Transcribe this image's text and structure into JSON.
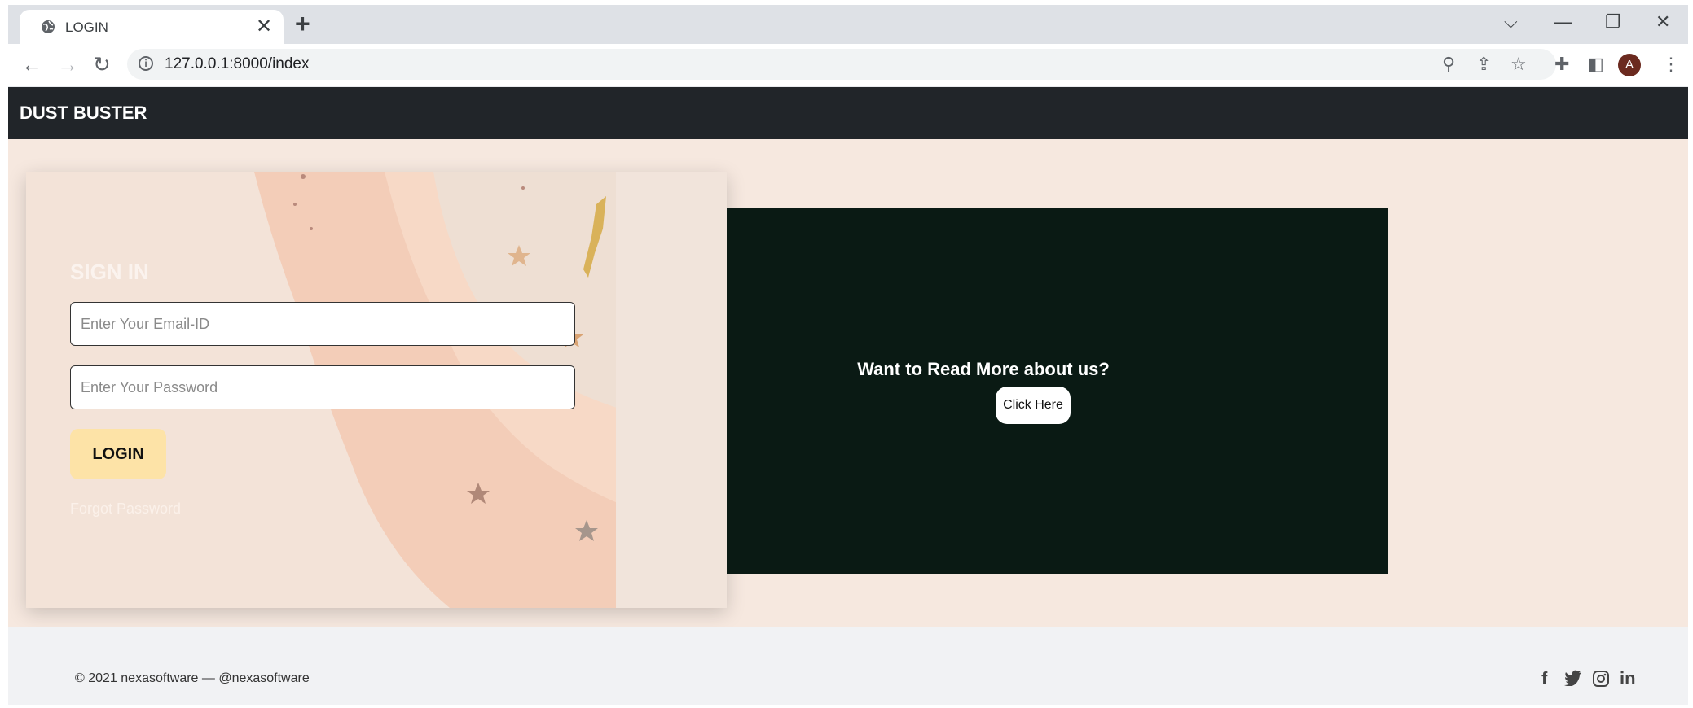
{
  "browser": {
    "tab_title": "LOGIN",
    "tab_close": "✕",
    "new_tab": "+",
    "url": "127.0.0.1:8000/index",
    "avatar_letter": "A",
    "icons": [
      "globe-icon",
      "back-icon",
      "forward-icon",
      "reload-icon",
      "info-icon",
      "zoom-icon",
      "share-icon",
      "star-icon",
      "extensions-icon",
      "sidepanel-icon",
      "menu-icon"
    ]
  },
  "navbar": {
    "brand": "DUST BUSTER"
  },
  "login": {
    "title": "SIGN IN",
    "email_placeholder": "Enter Your Email-ID",
    "password_placeholder": "Enter Your Password",
    "button": "LOGIN",
    "forgot": "Forgot Password"
  },
  "promo": {
    "text": "Want to Read More about us?",
    "button": "Click Here"
  },
  "footer": {
    "copyright": "© 2021 nexasoftware — @nexasoftware",
    "social": [
      "facebook",
      "twitter",
      "instagram",
      "linkedin"
    ]
  },
  "colors": {
    "navbar": "#212529",
    "page_bg": "#f6e8df",
    "promo_bg": "#0a1a14",
    "login_button": "#fde3a7",
    "footer_bg": "#f1f2f4"
  }
}
